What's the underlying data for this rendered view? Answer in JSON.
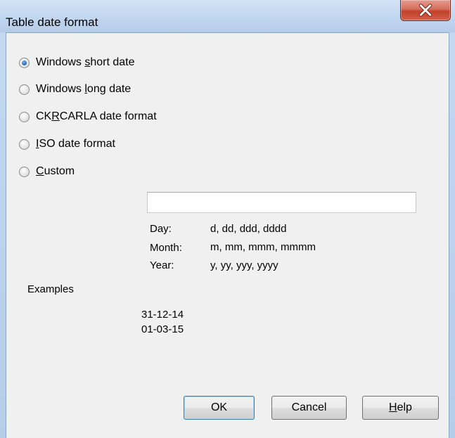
{
  "window": {
    "title": "Table date format"
  },
  "options": [
    {
      "pre": "Windows ",
      "accel": "s",
      "post": "hort date",
      "checked": true
    },
    {
      "pre": "Windows ",
      "accel": "l",
      "post": "ong date",
      "checked": false
    },
    {
      "pre": "CK",
      "accel": "R",
      "post": "CARLA date format",
      "checked": false
    },
    {
      "pre": "",
      "accel": "I",
      "post": "SO date format",
      "checked": false
    },
    {
      "pre": "",
      "accel": "C",
      "post": "ustom",
      "checked": false
    }
  ],
  "custom_input": {
    "value": ""
  },
  "hints": {
    "day_label": "Day:",
    "day_value": "d, dd, ddd, dddd",
    "month_label": "Month:",
    "month_value": "m, mm, mmm, mmmm",
    "year_label": "Year:",
    "year_value": "y, yy, yyy, yyyy"
  },
  "examples": {
    "heading": "Examples",
    "lines": [
      "31-12-14",
      "01-03-15"
    ]
  },
  "buttons": {
    "ok": "OK",
    "cancel": "Cancel",
    "help_accel": "H",
    "help_rest": "elp"
  },
  "colors": {
    "titlebar": "#c1d6ef",
    "close_button": "#c1412b",
    "dialog_bg": "#f0f0f0",
    "radio_selected": "#1f63b6",
    "default_button_border": "#3c7fb1"
  },
  "icons": {
    "close": "close-icon"
  }
}
